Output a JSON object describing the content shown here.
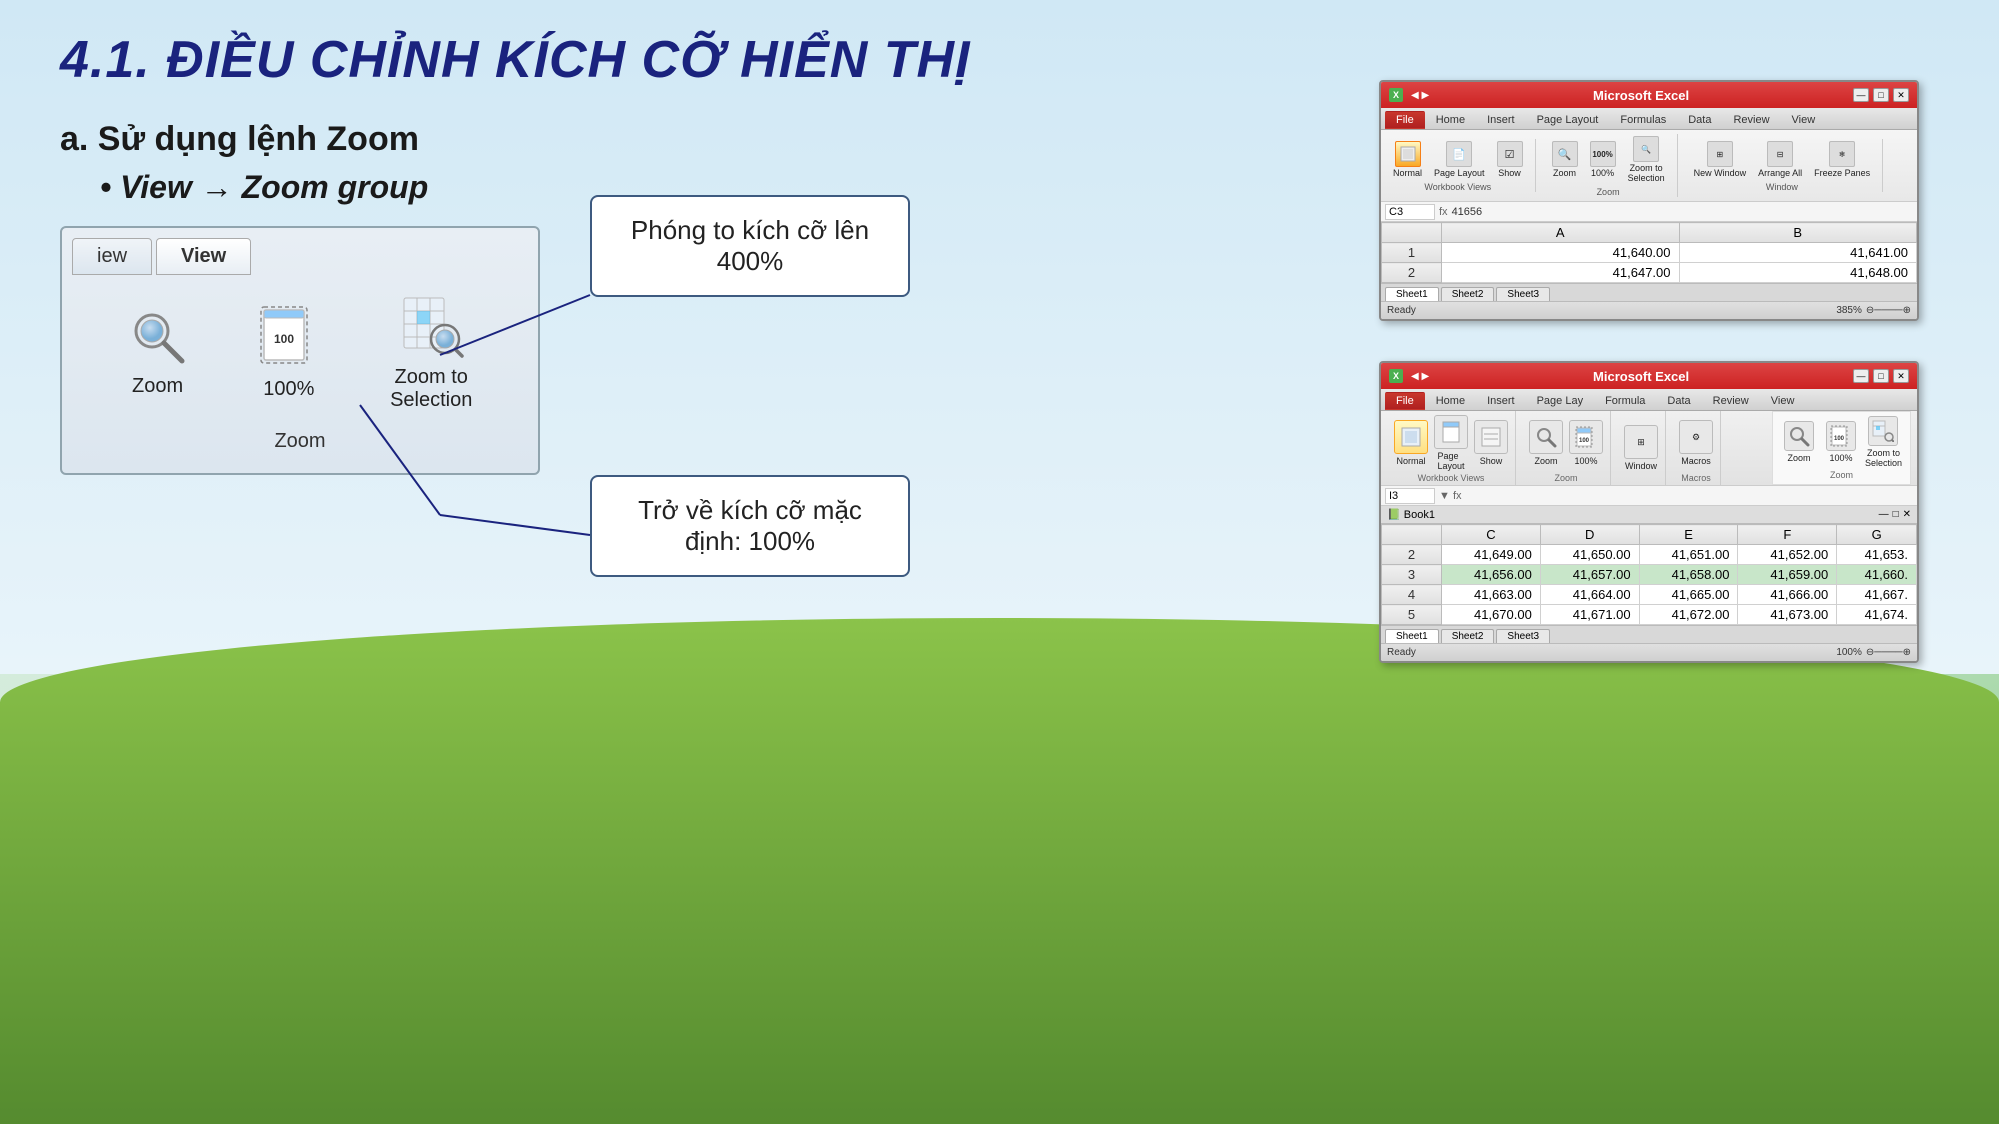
{
  "title": "4.1. ĐIỀU CHỈNH KÍCH CỠ HIỂN THỊ",
  "section_a": "a. Sử dụng lệnh Zoom",
  "bullet": "View → Zoom group",
  "callout_400": "Phóng to kích cỡ lên 400%",
  "callout_100": "Trở về kích cỡ mặc định: 100%",
  "zoom_group": {
    "tabs": [
      "iew",
      "View"
    ],
    "icons": [
      "Zoom",
      "100%",
      "Zoom to\nSelection"
    ],
    "label": "Zoom"
  },
  "excel1": {
    "title": "Microsoft Excel",
    "app_icon": "excel-icon",
    "tabs": [
      "File",
      "Home",
      "Insert",
      "Page Layout",
      "Formulas",
      "Data",
      "Review",
      "View"
    ],
    "active_tab": "View",
    "cell_ref": "C3",
    "formula": "41656",
    "columns": [
      "",
      "A",
      "B"
    ],
    "rows": [
      [
        "1",
        "41,640.00",
        "41,641.00"
      ],
      [
        "2",
        "41,647.00",
        "41,648.00"
      ]
    ],
    "sheet_tabs": [
      "Sheet1",
      "Sheet2",
      "Sheet3"
    ],
    "status_left": "Ready",
    "zoom_level": "385%"
  },
  "excel2": {
    "title": "Microsoft Excel",
    "app_icon": "excel-icon",
    "tabs": [
      "File",
      "Home",
      "Insert",
      "Page Lay",
      "Formula",
      "Data",
      "Review",
      "View"
    ],
    "active_tab": "View",
    "cell_ref": "I3",
    "ribbon_groups": {
      "workbook_views": {
        "label": "Workbook Views",
        "buttons": [
          "Normal",
          "Page Layout",
          "Show",
          "Zoom",
          "Window",
          "Macros"
        ]
      },
      "zoom_panel": {
        "label": "Zoom",
        "buttons": [
          "Zoom",
          "100%",
          "Zoom to\nSelection"
        ]
      }
    },
    "columns": [
      "",
      "C",
      "D",
      "E",
      "F",
      "G"
    ],
    "rows": [
      [
        "2",
        "41,649.00",
        "41,650.00",
        "41,651.00",
        "41,652.00",
        "41,653."
      ],
      [
        "3",
        "41,656.00",
        "41,657.00",
        "41,658.00",
        "41,659.00",
        "41,660."
      ],
      [
        "4",
        "41,663.00",
        "41,664.00",
        "41,665.00",
        "41,666.00",
        "41,667."
      ],
      [
        "5",
        "41,670.00",
        "41,671.00",
        "41,672.00",
        "41,673.00",
        "41,674."
      ]
    ],
    "sheet_tabs": [
      "Sheet1",
      "Sheet2",
      "Sheet3"
    ],
    "status_left": "Ready",
    "zoom_level": "100%"
  }
}
